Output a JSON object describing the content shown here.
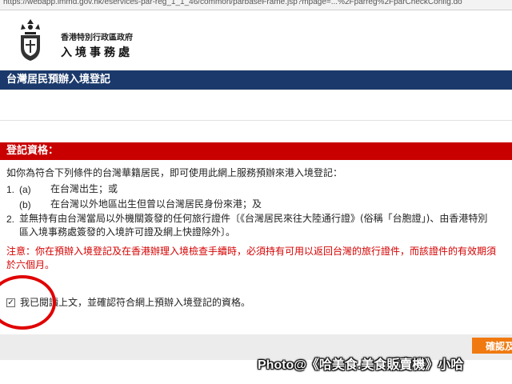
{
  "browser": {
    "url": "https://webapp.immd.gov.hk/eservices-par-reg_1_1_46/common/parbaseFrame.jsp?mpage=...%2Fparreg%2FparCheckConfig.do"
  },
  "header": {
    "dept_line1": "香港特別行政區政府",
    "dept_line2": "入境事務處"
  },
  "page_title": "台灣居民預辦入境登記",
  "eligibility": {
    "heading": "登記資格：",
    "intro": "如你為符合下列條件的台灣華籍居民，即可使用此網上服務預辦來港入境登記：",
    "item1_num": "1.",
    "item1a_label": "(a)",
    "item1a_text": "在台灣出生；或",
    "item1b_label": "(b)",
    "item1b_text": "在台灣以外地區出生但曾以台灣居民身份來港；及",
    "item2_num": "2.",
    "item2_line1": "並無持有由台灣當局以外機關簽發的任何旅行證件〔《台灣居民來往大陸通行證》(俗稱「台胞證」)、由香港特別",
    "item2_line2": "區入境事務處簽發的入境許可證及網上快證除外〕。"
  },
  "notice": {
    "line1": "注意：你在預辦入境登記及在香港辦理入境檢查手續時，必須持有可用以返回台灣的旅行證件，而該證件的有效期須",
    "line2": "於六個月。"
  },
  "agreement": {
    "checked_mark": "✓",
    "label": "我已閱讀上文，並確認符合網上預辦入境登記的資格。"
  },
  "actions": {
    "confirm_label": "確認及"
  },
  "watermark": "Photo@《哈美食.美食販賣機》小哈",
  "colors": {
    "title_bar": "#1b3a6b",
    "section_bar": "#c80000",
    "notice_text": "#d40000",
    "confirm_button": "#f07a10",
    "annotation_circle": "#e00000"
  }
}
